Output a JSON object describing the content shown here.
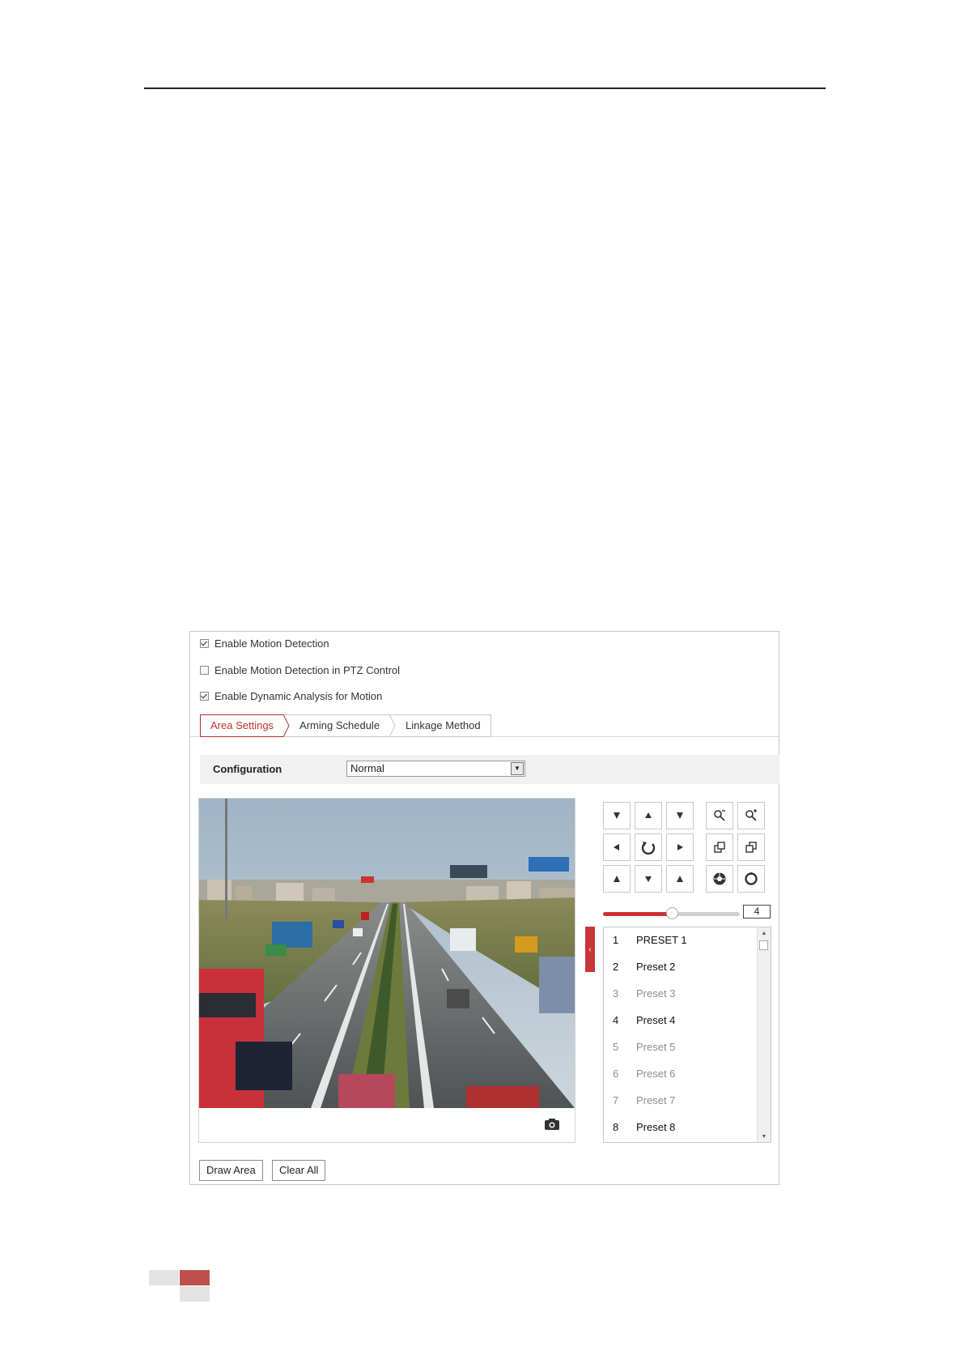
{
  "panel": {
    "checkboxes": [
      {
        "label": "Enable Motion Detection",
        "checked": true
      },
      {
        "label": "Enable Motion Detection in PTZ Control",
        "checked": false
      },
      {
        "label": "Enable Dynamic Analysis for Motion",
        "checked": true
      }
    ],
    "tabs": [
      {
        "label": "Area Settings",
        "active": true
      },
      {
        "label": "Arming Schedule",
        "active": false
      },
      {
        "label": "Linkage Method",
        "active": false
      }
    ],
    "configuration": {
      "label": "Configuration",
      "selected": "Normal"
    },
    "ptz": {
      "speed_value": "4",
      "speed_fraction": 0.5,
      "buttons": [
        "left-up-icon",
        "up-icon",
        "right-up-icon",
        "zoom-out-icon",
        "zoom-in-icon",
        "left-icon",
        "auto-rotate-icon",
        "right-icon",
        "focus-near-icon",
        "focus-far-icon",
        "left-down-icon",
        "down-icon",
        "right-down-icon",
        "iris-open-icon",
        "iris-close-icon"
      ]
    },
    "presets": [
      {
        "num": "1",
        "name": "PRESET 1",
        "set": true
      },
      {
        "num": "2",
        "name": "Preset 2",
        "set": true
      },
      {
        "num": "3",
        "name": "Preset 3",
        "set": false
      },
      {
        "num": "4",
        "name": "Preset 4",
        "set": true
      },
      {
        "num": "5",
        "name": "Preset 5",
        "set": false
      },
      {
        "num": "6",
        "name": "Preset 6",
        "set": false
      },
      {
        "num": "7",
        "name": "Preset 7",
        "set": false
      },
      {
        "num": "8",
        "name": "Preset 8",
        "set": true
      }
    ],
    "buttons": {
      "draw_area": "Draw Area",
      "clear_all": "Clear All"
    }
  },
  "colors": {
    "accent": "#c8353b",
    "tile_light": "#e3e3e3",
    "tile_red": "#c0504d"
  }
}
